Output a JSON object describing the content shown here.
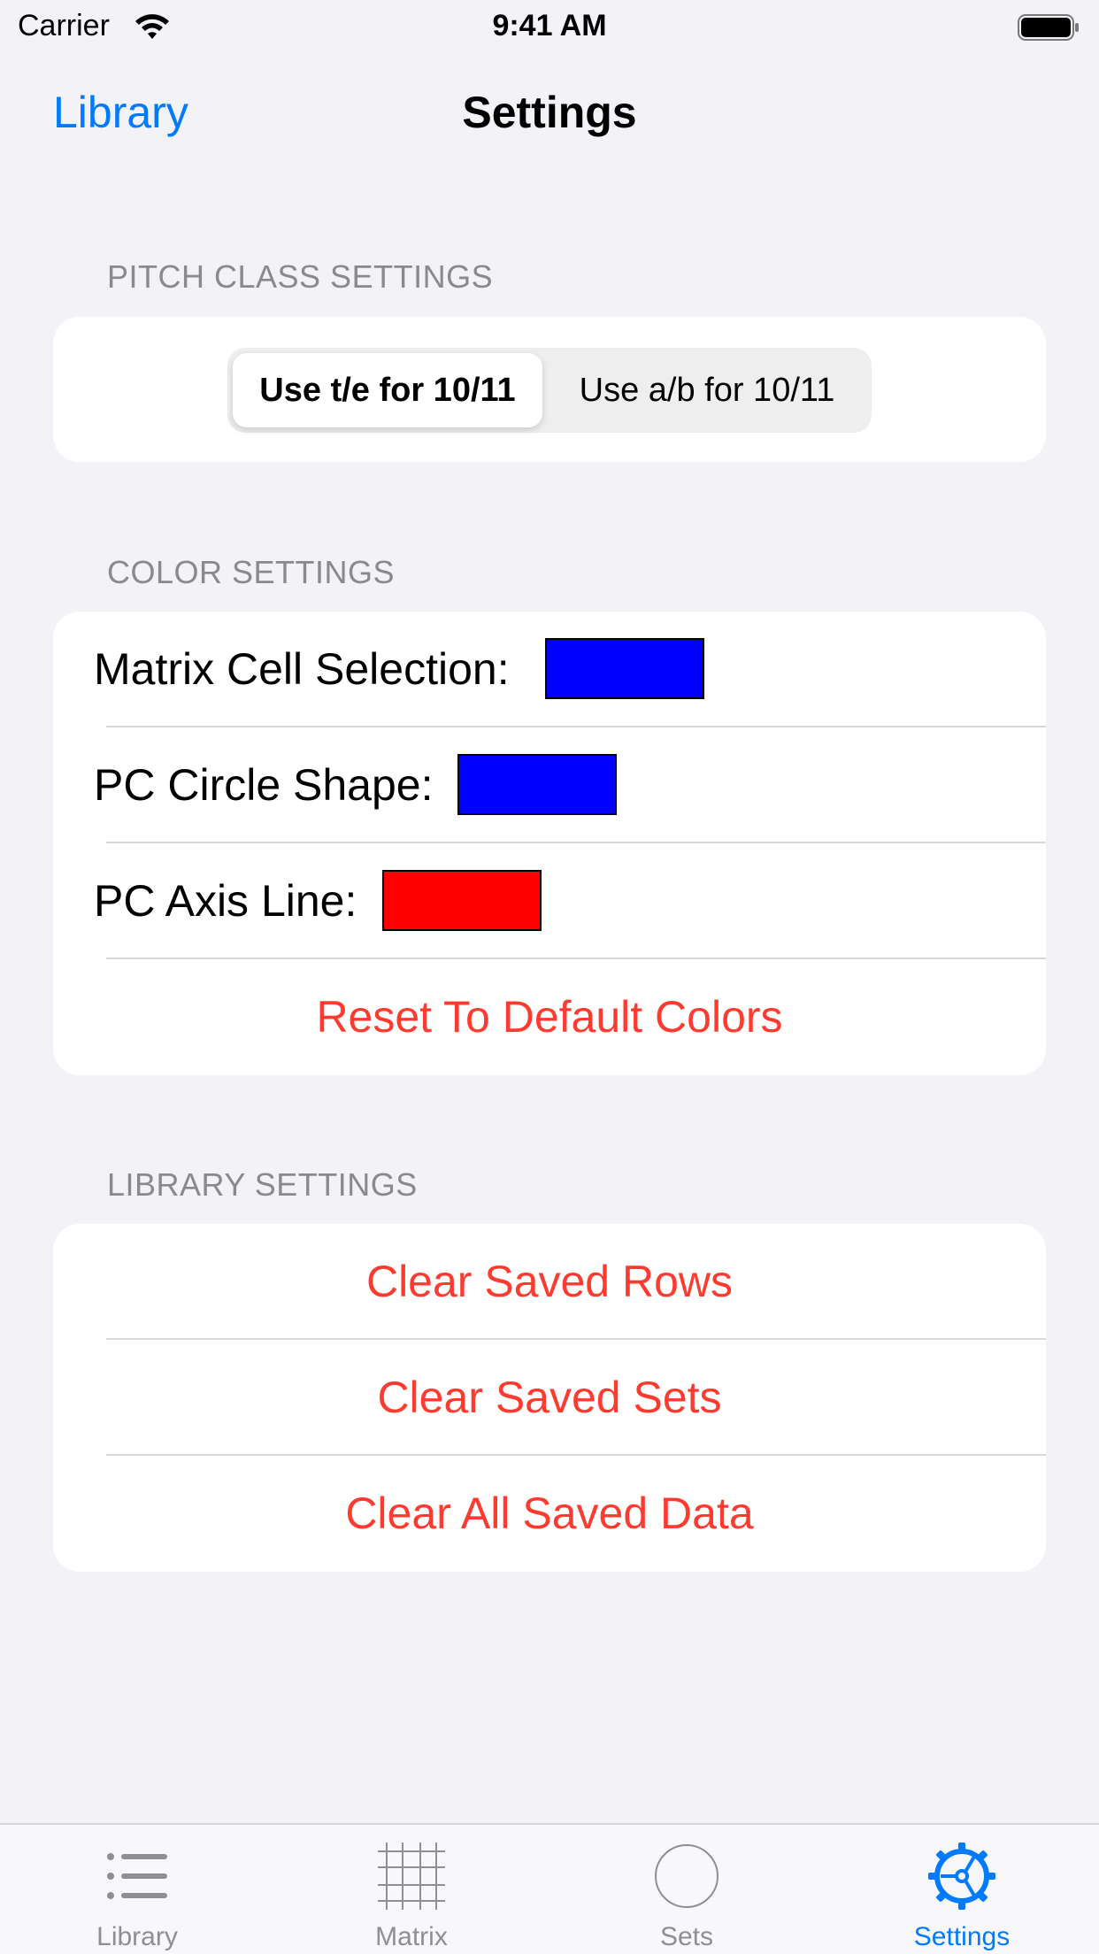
{
  "status_bar": {
    "carrier": "Carrier",
    "time": "9:41 AM"
  },
  "nav": {
    "back_label": "Library",
    "title": "Settings"
  },
  "pitch_class": {
    "header": "PITCH CLASS SETTINGS",
    "options": [
      "Use t/e for 10/11",
      "Use a/b for 10/11"
    ],
    "selected_index": 0
  },
  "colors": {
    "header": "COLOR SETTINGS",
    "rows": [
      {
        "label": "Matrix Cell Selection:",
        "color": "#0000ff"
      },
      {
        "label": "PC Circle Shape:",
        "color": "#0000ff"
      },
      {
        "label": "PC Axis Line:",
        "color": "#ff0000"
      }
    ],
    "reset_label": "Reset To Default Colors"
  },
  "library": {
    "header": "LIBRARY SETTINGS",
    "actions": [
      "Clear Saved Rows",
      "Clear Saved Sets",
      "Clear All Saved Data"
    ]
  },
  "tabs": [
    {
      "label": "Library",
      "icon": "list-icon",
      "active": false
    },
    {
      "label": "Matrix",
      "icon": "grid-icon",
      "active": false
    },
    {
      "label": "Sets",
      "icon": "circle-icon",
      "active": false
    },
    {
      "label": "Settings",
      "icon": "gear-icon",
      "active": true
    }
  ],
  "theme": {
    "accent": "#007aff",
    "destructive": "#ff3b30"
  }
}
